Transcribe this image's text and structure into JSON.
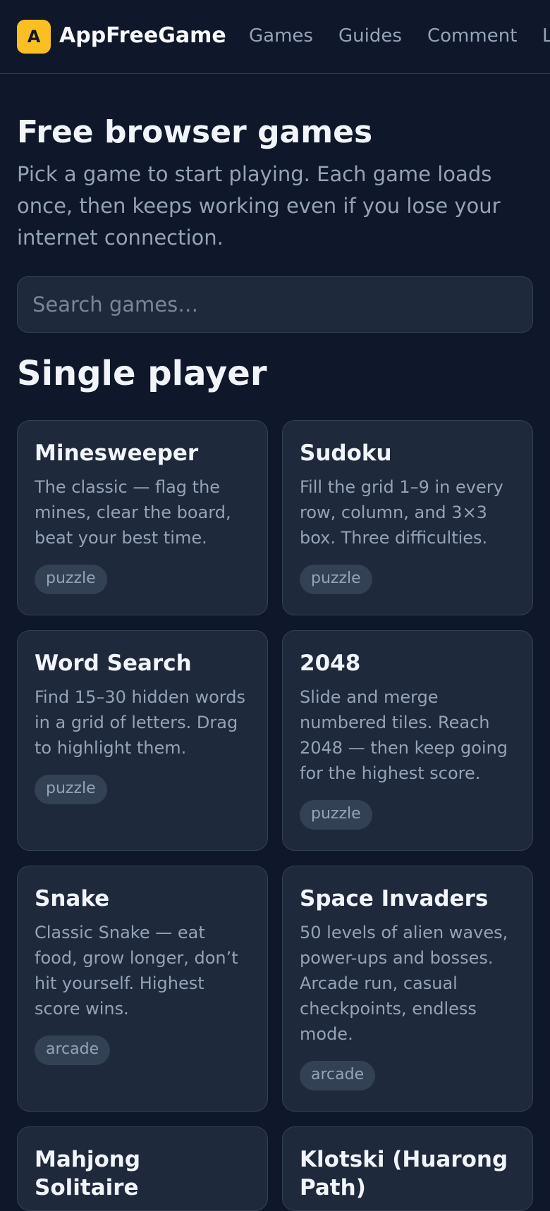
{
  "header": {
    "logo_letter": "A",
    "brand": "AppFreeGame",
    "nav": [
      "Games",
      "Guides",
      "Comment",
      "L"
    ]
  },
  "hero": {
    "title": "Free browser games",
    "intro": "Pick a game to start playing. Each game loads once, then keeps working even if you lose your internet connection."
  },
  "search": {
    "placeholder": "Search games…",
    "value": ""
  },
  "sections": [
    {
      "title": "Single player",
      "games": [
        {
          "title": "Minesweeper",
          "desc": "The classic — flag the mines, clear the board, beat your best time.",
          "tag": "puzzle"
        },
        {
          "title": "Sudoku",
          "desc": "Fill the grid 1–9 in every row, column, and 3×3 box. Three difficulties.",
          "tag": "puzzle"
        },
        {
          "title": "Word Search",
          "desc": "Find 15–30 hidden words in a grid of letters. Drag to highlight them.",
          "tag": "puzzle"
        },
        {
          "title": "2048",
          "desc": "Slide and merge numbered tiles. Reach 2048 — then keep going for the highest score.",
          "tag": "puzzle"
        },
        {
          "title": "Snake",
          "desc": "Classic Snake — eat food, grow longer, don’t hit yourself. Highest score wins.",
          "tag": "arcade"
        },
        {
          "title": "Space Invaders",
          "desc": "50 levels of alien waves, power-ups and bosses. Arcade run, casual checkpoints, endless mode.",
          "tag": "arcade"
        },
        {
          "title": "Mahjong Solitaire",
          "desc": "",
          "tag": ""
        },
        {
          "title": "Klotski (Huarong Path)",
          "desc": "",
          "tag": ""
        }
      ]
    }
  ]
}
